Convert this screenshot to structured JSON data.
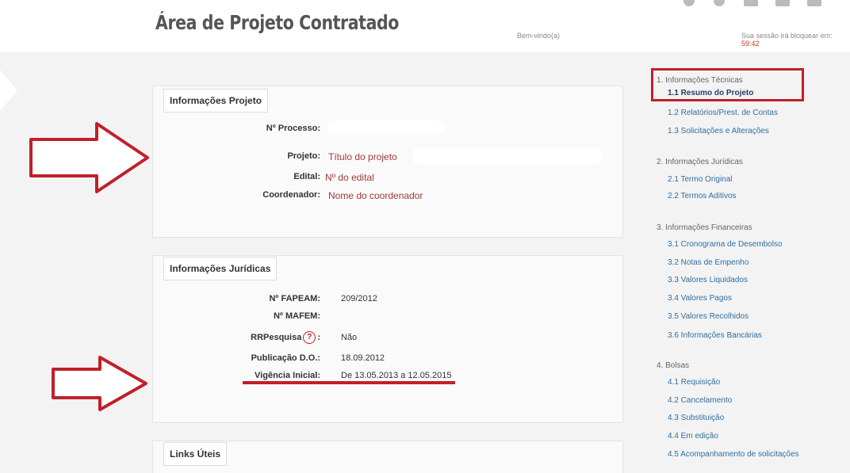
{
  "header": {
    "title": "Área de Projeto Contratado",
    "welcome": "Bem-vindo(a)",
    "session_label": "Sua sessão irá bloquear em:",
    "session_time": "59:42"
  },
  "informacoes_projeto": {
    "heading": "Informações Projeto",
    "fields": [
      {
        "label": "Nº Processo:",
        "value": ""
      },
      {
        "label": "Projeto:",
        "value": "Título do projeto"
      },
      {
        "label": "Edital:",
        "value": "Nº do edital"
      },
      {
        "label": "Coordenador:",
        "value": "Nome do coordenador"
      }
    ]
  },
  "informacoes_juridicas": {
    "heading": "Informações Jurídicas",
    "fields": [
      {
        "label": "Nº FAPEAM:",
        "value": "209/2012"
      },
      {
        "label": "Nº MAFEM:",
        "value": ""
      },
      {
        "label": "RRPesquisa",
        "value": "Não"
      },
      {
        "label": "Publicação D.O.:",
        "value": "18.09.2012"
      },
      {
        "label": "Vigência Inicial:",
        "value": "De 13.05.2013 a 12.05.2015"
      }
    ]
  },
  "links_uteis": {
    "heading": "Links Úteis"
  },
  "sidebar": {
    "sections": [
      {
        "title": "1. Informações Técnicas",
        "items": [
          "1.1 Resumo do Projeto",
          "1.2 Relatórios/Prest. de Contas",
          "1.3 Solicitações e Alterações"
        ]
      },
      {
        "title": "2. Informações Jurídicas",
        "items": [
          "2.1 Termo Original",
          "2.2 Termos Aditivos"
        ]
      },
      {
        "title": "3. Informações Financeiras",
        "items": [
          "3.1 Cronograma de Desembolso",
          "3.2 Notas de Empenho",
          "3.3 Valores Liquidados",
          "3.4 Valores Pagos",
          "3.5 Valores Recolhidos",
          "3.6 Informações Bancárias"
        ]
      },
      {
        "title": "4. Bolsas",
        "items": [
          "4.1 Requisição",
          "4.2 Cancelamento",
          "4.3 Substituição",
          "4.4 Em edição",
          "4.5 Acompanhamento de solicitações"
        ]
      }
    ],
    "active_item": "1.1 Resumo do Projeto"
  },
  "colors": {
    "highlight": "#c0202a",
    "link": "#2f6fa2",
    "value": "#a33a3a"
  },
  "icons": [
    "arrow-right-outline-icon",
    "help-circle-icon"
  ]
}
